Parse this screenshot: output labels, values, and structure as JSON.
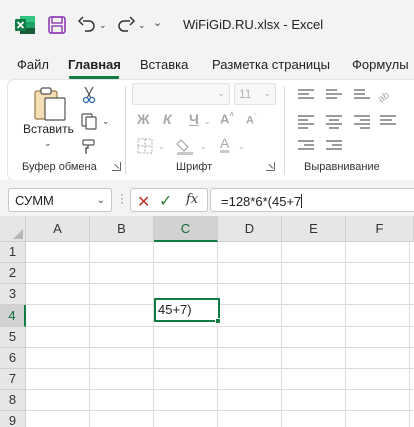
{
  "titlebar": {
    "document_title": "WiFiGiD.RU.xlsx  -  Excel"
  },
  "tabs": [
    {
      "label": "Файл"
    },
    {
      "label": "Главная",
      "active": true
    },
    {
      "label": "Вставка"
    },
    {
      "label": "Разметка страницы"
    },
    {
      "label": "Формулы"
    }
  ],
  "ribbon": {
    "clipboard": {
      "paste_label": "Вставить",
      "group_label": "Буфер обмена"
    },
    "font": {
      "font_size": "11",
      "bold": "Ж",
      "italic": "К",
      "underline": "Ч",
      "font_color_glyph": "A",
      "group_label": "Шрифт"
    },
    "alignment": {
      "group_label": "Выравнивание"
    }
  },
  "formula_bar": {
    "name_box": "СУММ",
    "fx": "fx",
    "formula": "=128*6*(45+7"
  },
  "sheet": {
    "columns": [
      "A",
      "B",
      "C",
      "D",
      "E",
      "F"
    ],
    "selected_column": "C",
    "rows": [
      "1",
      "2",
      "3",
      "4",
      "5",
      "6",
      "7",
      "8",
      "9"
    ],
    "selected_row": "4",
    "active_cell_text": "45+7)"
  },
  "colors": {
    "excel_green": "#107c41",
    "cancel_red": "#c0392b",
    "enter_green": "#2e7d32"
  }
}
